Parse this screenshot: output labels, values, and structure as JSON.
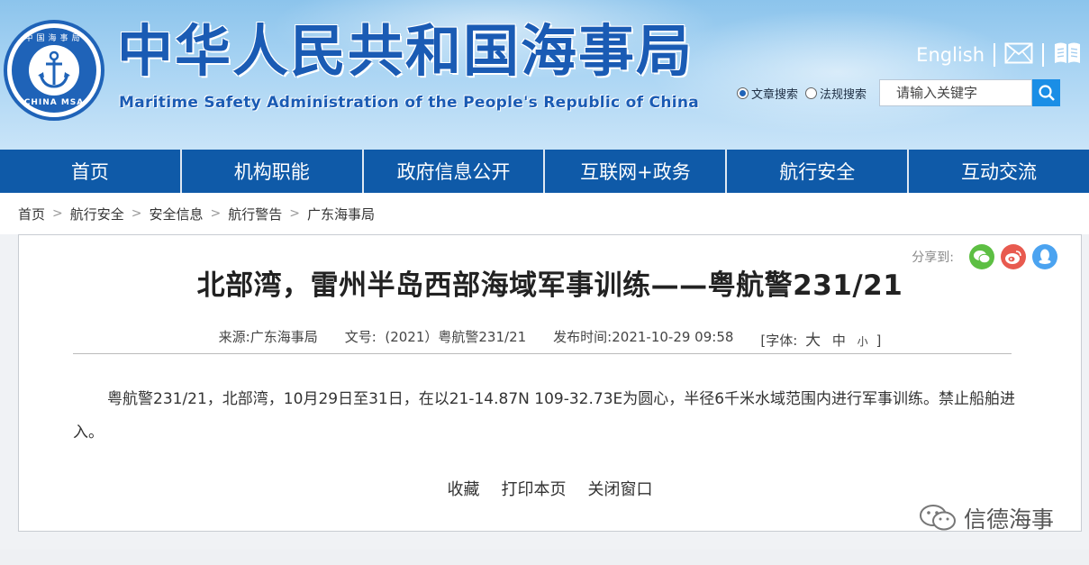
{
  "header": {
    "emblem_top": "中国海事局",
    "emblem_bottom": "CHINA MSA",
    "title": "中华人民共和国海事局",
    "subtitle": "Maritime Safety Administration of the People's Republic of China",
    "language_link": "English",
    "mail_icon": "mail-icon",
    "book_icon": "book-icon",
    "search": {
      "option_article": "文章搜索",
      "option_regulation": "法规搜索",
      "placeholder": "请输入关键字",
      "selected": "文章搜索"
    }
  },
  "nav": {
    "items": [
      {
        "label": "首页"
      },
      {
        "label": "机构职能"
      },
      {
        "label": "政府信息公开"
      },
      {
        "label": "互联网+政务"
      },
      {
        "label": "航行安全"
      },
      {
        "label": "互动交流"
      }
    ]
  },
  "breadcrumb": {
    "items": [
      "首页",
      "航行安全",
      "安全信息",
      "航行警告",
      "广东海事局"
    ],
    "separator": ">"
  },
  "article": {
    "share_label": "分享到:",
    "share_colors": {
      "wechat": "#5dbf43",
      "weibo": "#e85a4f",
      "qq": "#4ba3f0"
    },
    "title": "北部湾，雷州半岛西部海域军事训练——粤航警231/21",
    "meta": {
      "source_label": "来源:",
      "source": "广东海事局",
      "doc_label": "文号:",
      "doc_no": "(2021）粤航警231/21",
      "time_label": "发布时间:",
      "time": "2021-10-29 09:58",
      "font_label": "[字体:",
      "font_large": "大",
      "font_medium": "中",
      "font_small": "小",
      "font_close": "]"
    },
    "body": "粤航警231/21，北部湾，10月29日至31日，在以21-14.87N 109-32.73E为圆心，半径6千米水域范围内进行军事训练。禁止船舶进入。",
    "actions": {
      "favorite": "收藏",
      "print": "打印本页",
      "close": "关闭窗口"
    },
    "watermark": "信德海事"
  },
  "colors": {
    "brand_blue": "#1a5bb4",
    "nav_bg": "#0f5aa8",
    "search_button": "#1a8ee6"
  }
}
